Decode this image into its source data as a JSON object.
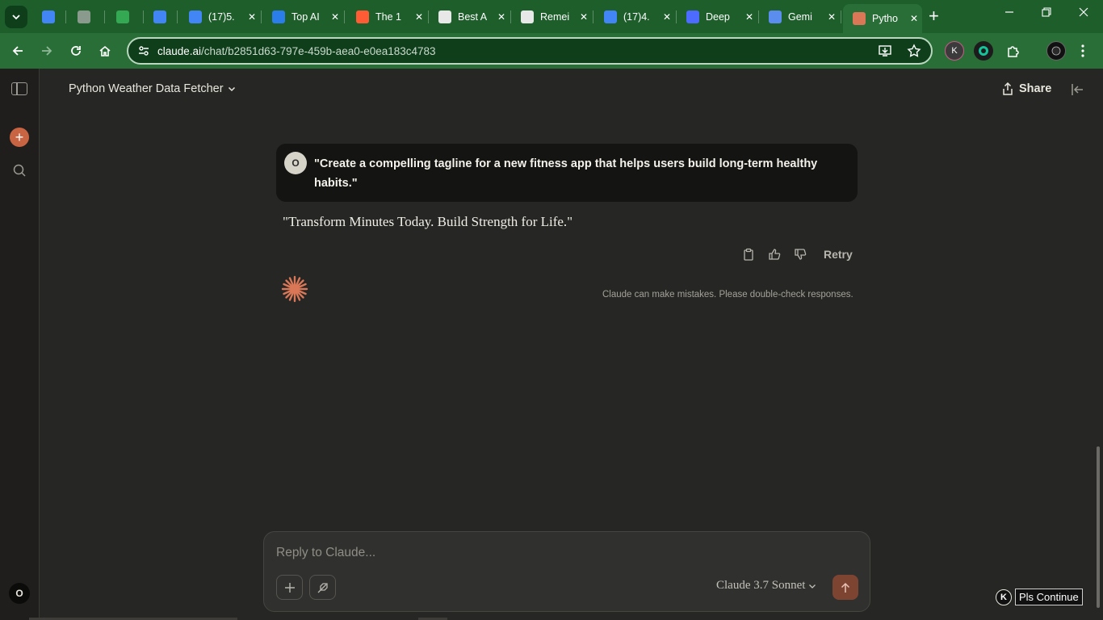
{
  "browser": {
    "tabs": [
      {
        "label": "",
        "favicon": "google-docs-icon",
        "color": "#4285f4",
        "closable": false
      },
      {
        "label": "",
        "favicon": "globe-icon",
        "color": "#8a9b8d",
        "closable": false
      },
      {
        "label": "",
        "favicon": "google-sheets-icon",
        "color": "#34a853",
        "closable": false
      },
      {
        "label": "",
        "favicon": "google-docs-icon",
        "color": "#4285f4",
        "closable": false
      },
      {
        "label": "(17)5.",
        "favicon": "google-docs-icon",
        "color": "#4285f4",
        "closable": true
      },
      {
        "label": "Top AI",
        "favicon": "swirl-icon",
        "color": "#2b7de9",
        "closable": true
      },
      {
        "label": "The 1",
        "favicon": "hubspot-icon",
        "color": "#ff5c35",
        "closable": true
      },
      {
        "label": "Best A",
        "favicon": "columns-icon",
        "color": "#e8e8e8",
        "closable": true
      },
      {
        "label": "Remei",
        "favicon": "openai-icon",
        "color": "#e8e8e8",
        "closable": true
      },
      {
        "label": "(17)4.",
        "favicon": "google-docs-icon",
        "color": "#4285f4",
        "closable": true
      },
      {
        "label": "Deep",
        "favicon": "deepseek-icon",
        "color": "#4d6bfe",
        "closable": true
      },
      {
        "label": "Gemi",
        "favicon": "gemini-icon",
        "color": "#5b8def",
        "closable": true
      },
      {
        "label": "Pytho",
        "favicon": "claude-icon",
        "color": "#d97757",
        "closable": true,
        "active": true
      }
    ],
    "url_domain": "claude.ai",
    "url_path": "/chat/b2851d63-797e-459b-aea0-e0ea183c4783",
    "extension_k": "K"
  },
  "chat": {
    "title": "Python Weather Data Fetcher",
    "share_label": "Share",
    "user_initial": "O",
    "user_message": "\"Create a compelling tagline for a new fitness app that helps users build long-term healthy habits.\"",
    "assistant_reply": "\"Transform Minutes Today. Build Strength for Life.\"",
    "retry_label": "Retry",
    "disclaimer": "Claude can make mistakes. Please double-check responses."
  },
  "composer": {
    "placeholder": "Reply to Claude...",
    "model": "Claude 3.7 Sonnet"
  },
  "sidebar": {
    "user_initial": "O"
  },
  "overlay": {
    "k_badge": "K",
    "button_label": "Pls Continue"
  },
  "colors": {
    "accent": "#c96442",
    "browser_frame": "#2a6e37",
    "background": "#262624"
  }
}
